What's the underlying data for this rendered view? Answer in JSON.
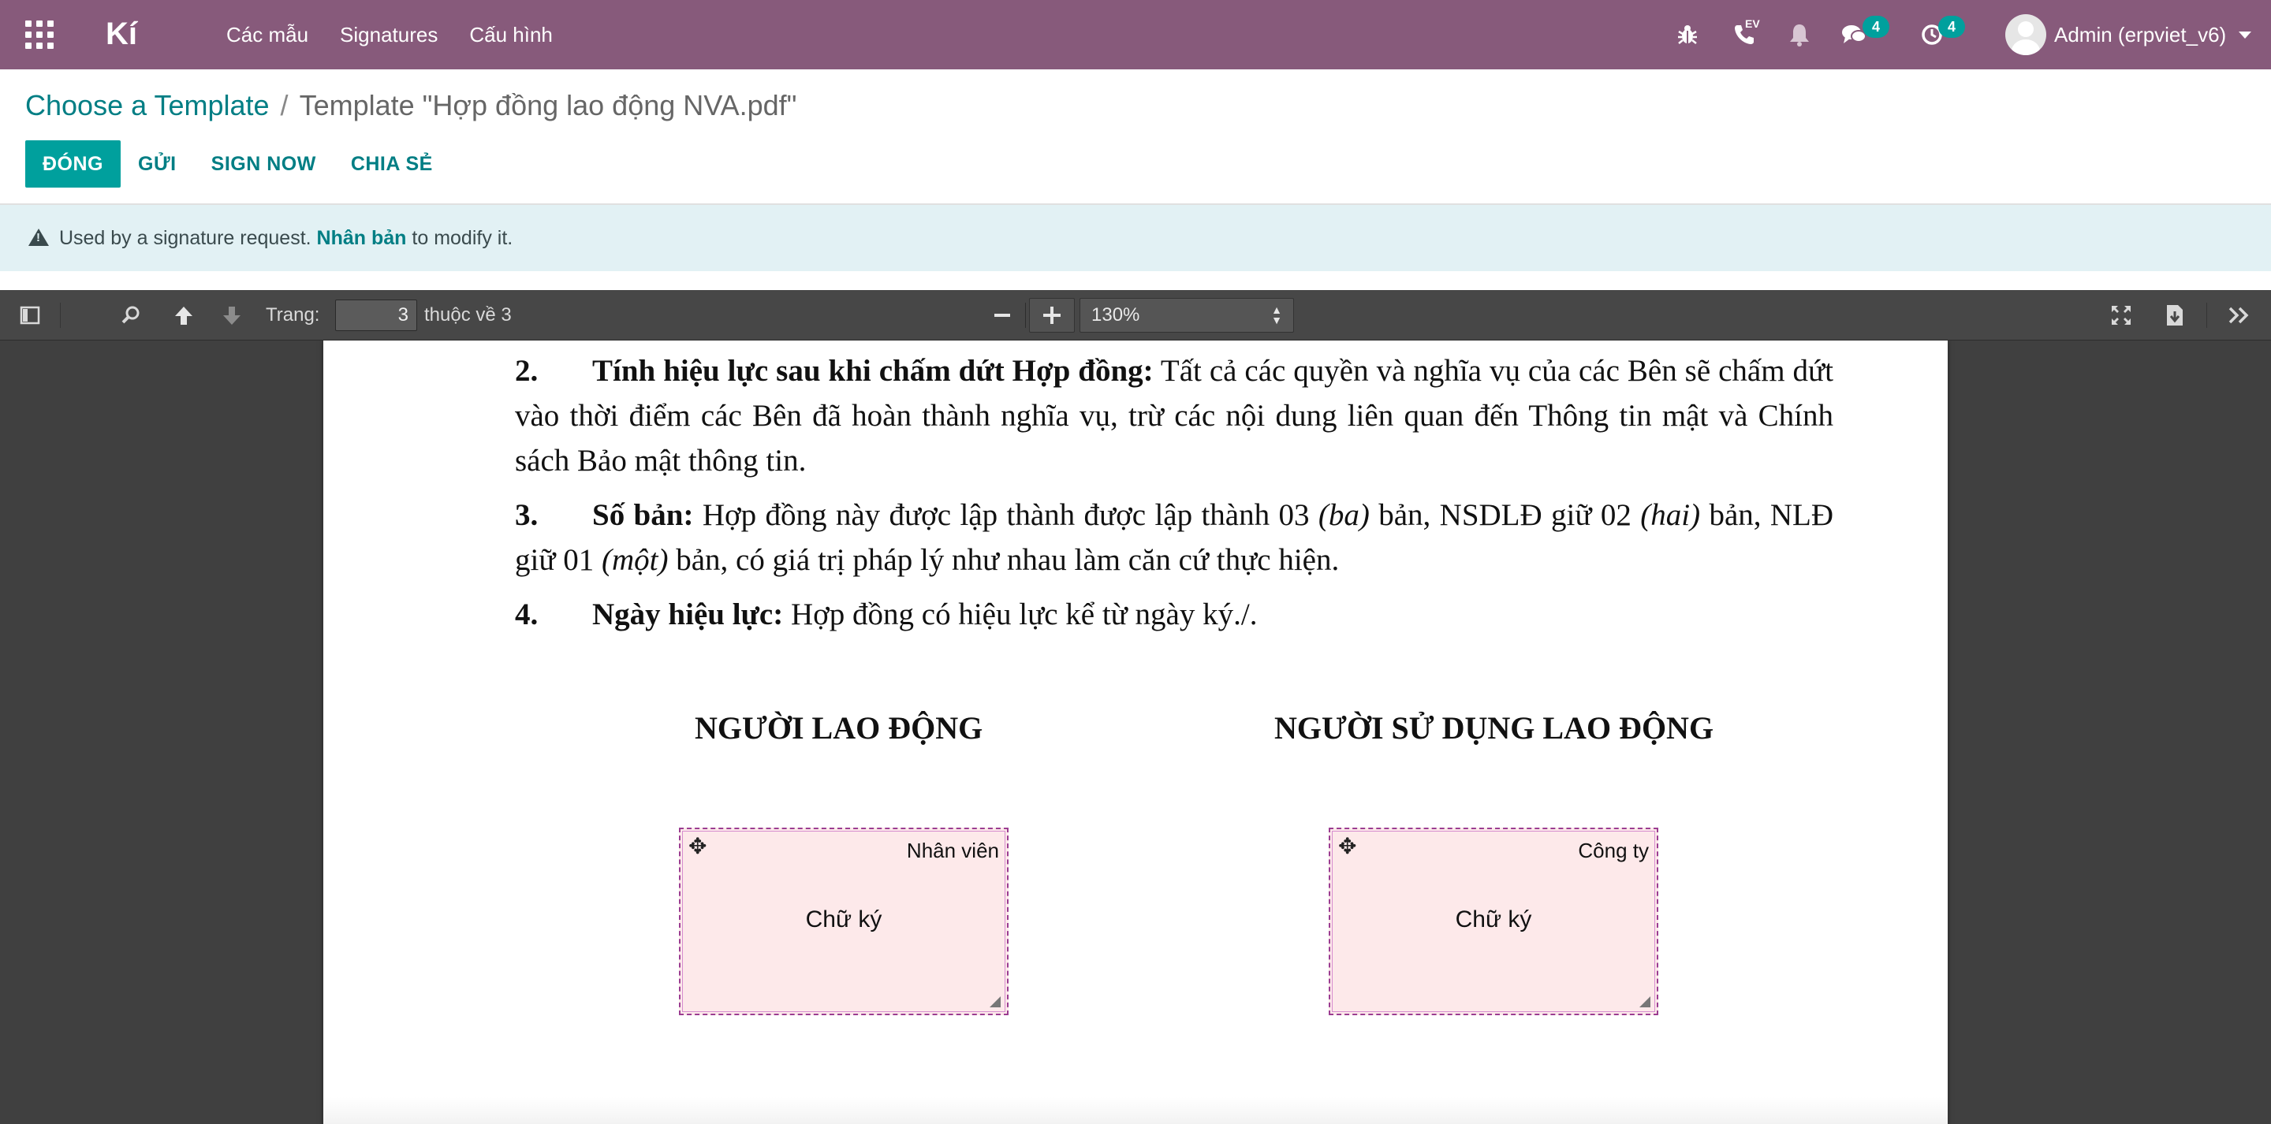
{
  "navbar": {
    "brand": "Kí",
    "menu": [
      "Các mẫu",
      "Signatures",
      "Cấu hình"
    ],
    "badges": {
      "messages": "4",
      "activities": "4"
    },
    "phone_badge": "EV",
    "user_name": "Admin (erpviet_v6)"
  },
  "breadcrumb": {
    "parent": "Choose a Template",
    "separator": "/",
    "current": "Template \"Hợp đồng lao động NVA.pdf\""
  },
  "actions": {
    "close": "ĐÓNG",
    "send": "GỬI",
    "sign_now": "SIGN NOW",
    "share": "CHIA SẺ"
  },
  "alert": {
    "prefix": "Used by a signature request.",
    "link": "Nhân bản",
    "suffix": "to modify it."
  },
  "pdf_toolbar": {
    "page_label": "Trang:",
    "page_value": "3",
    "page_of": "thuộc về 3",
    "zoom_value": "130%"
  },
  "document": {
    "items": [
      {
        "num": "2.",
        "title": "Tính hiệu lực sau khi chấm dứt Hợp đồng:",
        "text": "Tất cả các quyền và nghĩa vụ của các Bên sẽ chấm dứt vào thời điểm các Bên đã hoàn thành nghĩa vụ, trừ các nội dung liên quan đến Thông tin mật và Chính sách Bảo mật thông tin."
      },
      {
        "num": "3.",
        "title": "Số bản:",
        "text_a": "Hợp đồng này được lập thành được lập thành 03",
        "ital_a": "(ba)",
        "text_b": "bản, NSDLĐ giữ 02",
        "ital_b": "(hai)",
        "text_c": "bản, NLĐ giữ 01",
        "ital_c": "(một)",
        "text_d": "bản, có giá trị pháp lý như nhau làm căn cứ thực hiện."
      },
      {
        "num": "4.",
        "title": "Ngày hiệu lực:",
        "text": "Hợp đồng có hiệu lực kể từ ngày ký./."
      }
    ],
    "employee_heading": "NGƯỜI LAO ĐỘNG",
    "employer_heading": "NGƯỜI SỬ DỤNG LAO ĐỘNG",
    "sign_fields": [
      {
        "role": "Nhân viên",
        "label": "Chữ ký"
      },
      {
        "role": "Công ty",
        "label": "Chữ ký"
      }
    ]
  }
}
